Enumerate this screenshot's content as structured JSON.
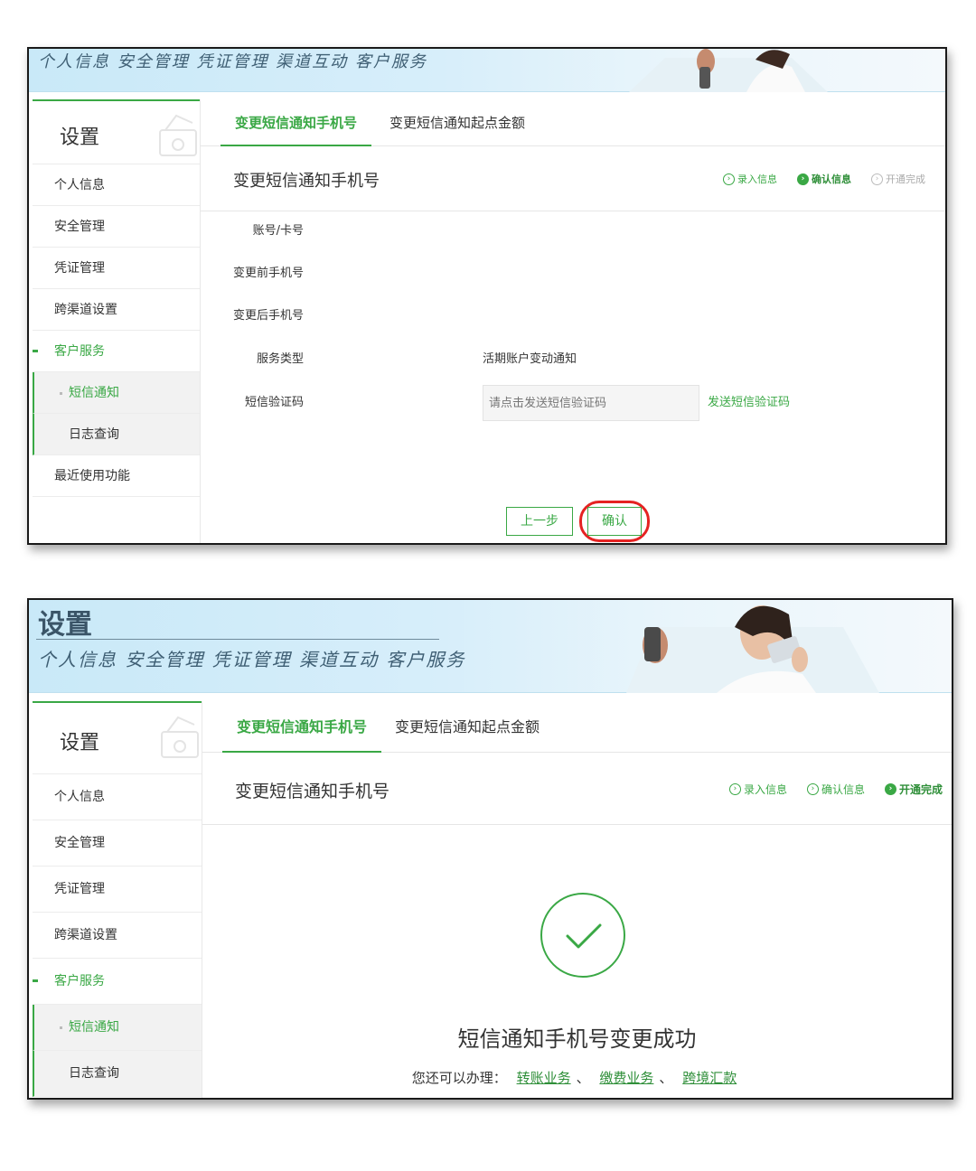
{
  "banner": {
    "title": "设置",
    "nav_text": "个人信息 安全管理 凭证管理 渠道互动 客户服务"
  },
  "sidebar": {
    "title": "设置",
    "items": [
      {
        "label": "个人信息"
      },
      {
        "label": "安全管理"
      },
      {
        "label": "凭证管理"
      },
      {
        "label": "跨渠道设置"
      },
      {
        "label": "客户服务"
      }
    ],
    "sub_items": [
      {
        "label": "短信通知"
      },
      {
        "label": "日志查询"
      }
    ],
    "recent": "最近使用功能"
  },
  "tabs": [
    {
      "label": "变更短信通知手机号"
    },
    {
      "label": "变更短信通知起点金额"
    }
  ],
  "section_title": "变更短信通知手机号",
  "steps": [
    {
      "label": "录入信息"
    },
    {
      "label": "确认信息"
    },
    {
      "label": "开通完成"
    }
  ],
  "form": {
    "account_label": "账号/卡号",
    "old_phone_label": "变更前手机号",
    "new_phone_label": "变更后手机号",
    "service_type_label": "服务类型",
    "service_type_value": "活期账户变动通知",
    "sms_code_label": "短信验证码",
    "sms_code_placeholder": "请点击发送短信验证码",
    "send_code_link": "发送短信验证码"
  },
  "buttons": {
    "prev": "上一步",
    "confirm": "确认"
  },
  "success": {
    "message": "短信通知手机号变更成功",
    "more_prefix": "您还可以办理：",
    "links": [
      "转账业务",
      "缴费业务",
      "跨境汇款"
    ],
    "separator": "、"
  },
  "colors": {
    "brand_green": "#3aa845",
    "highlight_red": "#e52222",
    "banner_blue": "#c9e9f8"
  }
}
